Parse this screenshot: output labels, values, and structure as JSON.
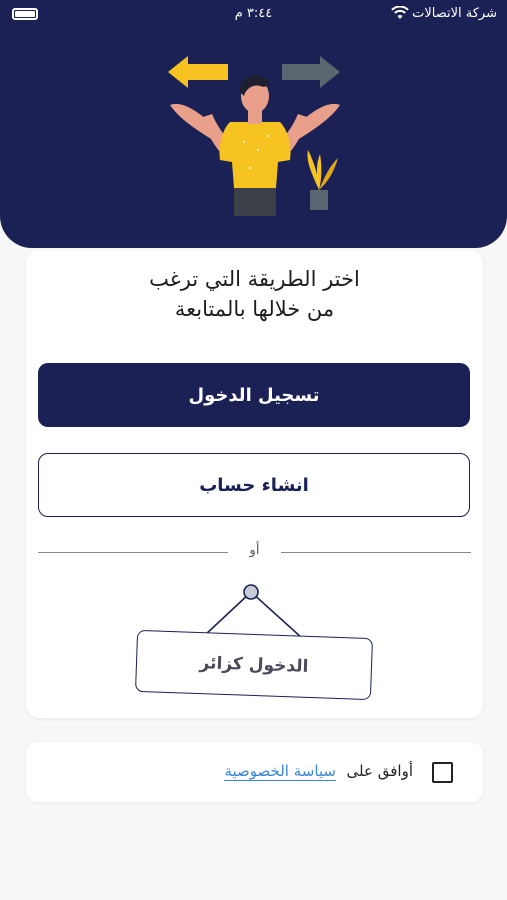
{
  "status_bar": {
    "carrier": "شركة الاتصالات",
    "time": "٣:٤٤ م"
  },
  "card": {
    "heading": "اختر الطريقة التي ترغب من خلالها بالمتابعة",
    "login_label": "تسجيل الدخول",
    "register_label": "انشاء حساب",
    "divider_text": "أو",
    "guest_label": "الدخول كزائر"
  },
  "agree": {
    "prefix": "أوافق على",
    "policy_link": "سياسة الخصوصية"
  },
  "colors": {
    "primary": "#1b2155",
    "link": "#3a86d6",
    "arrow_yellow": "#f7c321",
    "arrow_gray": "#5b6670"
  },
  "icons": {
    "wifi": "wifi-icon",
    "battery": "battery-icon",
    "illustration": "person-choosing-direction-illustration"
  }
}
